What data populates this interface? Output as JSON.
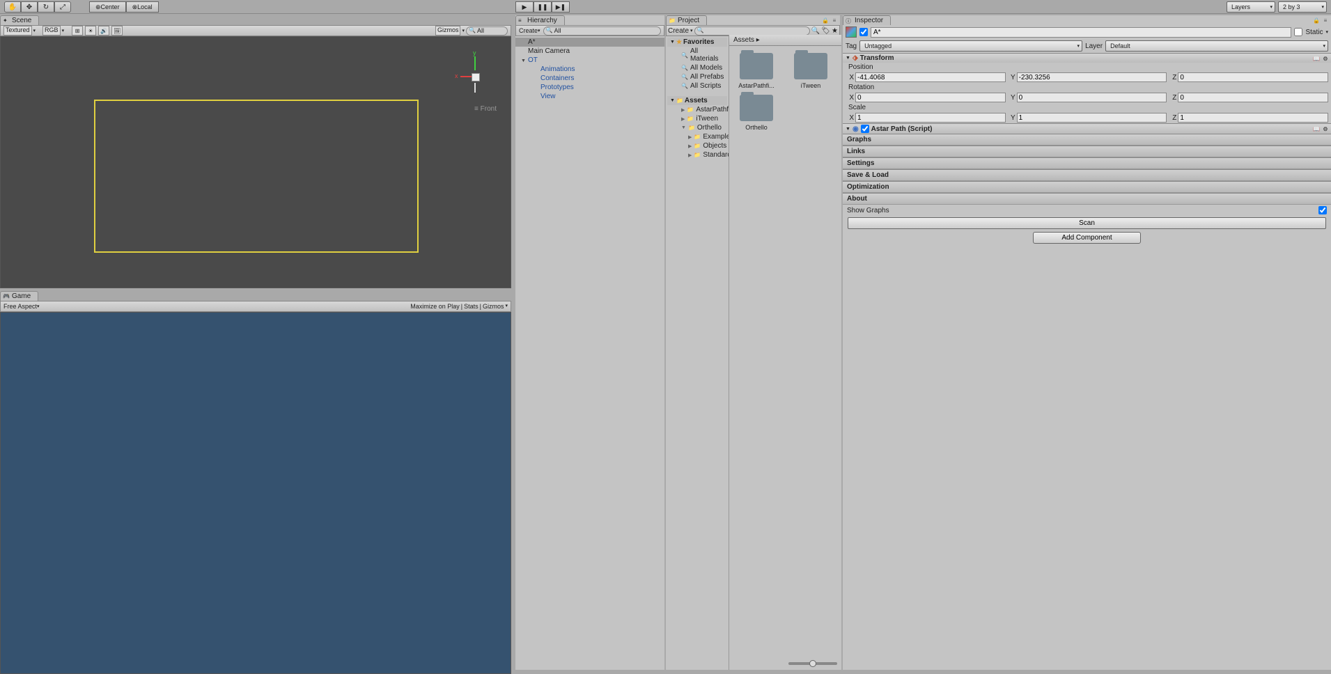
{
  "toolbar": {
    "tools": [
      "✋",
      "✥",
      "↻",
      "⤢"
    ],
    "center_label": "Center",
    "local_label": "Local",
    "play_icons": [
      "▶",
      "❚❚",
      "▶❚"
    ],
    "layers_label": "Layers",
    "layout_label": "2 by 3"
  },
  "scene": {
    "tab_label": "Scene",
    "shading": "Textured",
    "render_mode": "RGB",
    "gizmos_label": "Gizmos",
    "search_placeholder": "All",
    "front_label": "Front"
  },
  "game": {
    "tab_label": "Game",
    "aspect_label": "Free Aspect",
    "maximize_label": "Maximize on Play",
    "stats_label": "Stats",
    "gizmos_label": "Gizmos"
  },
  "hierarchy": {
    "tab_label": "Hierarchy",
    "create_label": "Create",
    "search_placeholder": "All",
    "items": [
      {
        "label": "A*",
        "selected": true,
        "depth": 0
      },
      {
        "label": "Main Camera",
        "depth": 0
      },
      {
        "label": "OT",
        "depth": 0,
        "expand": true,
        "prefab": true
      },
      {
        "label": "Animations",
        "depth": 1,
        "prefab": true
      },
      {
        "label": "Containers",
        "depth": 1,
        "prefab": true
      },
      {
        "label": "Prototypes",
        "depth": 1,
        "prefab": true
      },
      {
        "label": "View",
        "depth": 1,
        "prefab": true
      }
    ]
  },
  "project": {
    "tab_label": "Project",
    "create_label": "Create",
    "favorites_label": "Favorites",
    "favorites": [
      "All Materials",
      "All Models",
      "All Prefabs",
      "All Scripts"
    ],
    "assets_label": "Assets",
    "folders": [
      {
        "label": "AstarPathfind",
        "depth": 1
      },
      {
        "label": "iTween",
        "depth": 1
      },
      {
        "label": "Orthello",
        "depth": 1,
        "expand": true
      },
      {
        "label": "Examples",
        "depth": 2
      },
      {
        "label": "Objects",
        "depth": 2
      },
      {
        "label": "Standard",
        "depth": 2
      }
    ],
    "breadcrumb": "Assets",
    "grid_items": [
      "AstarPathfi...",
      "iTween",
      "Orthello"
    ]
  },
  "inspector": {
    "tab_label": "Inspector",
    "object_name": "A*",
    "static_label": "Static",
    "tag_label": "Tag",
    "tag_value": "Untagged",
    "layer_label": "Layer",
    "layer_value": "Default",
    "transform": {
      "title": "Transform",
      "position_label": "Position",
      "position": {
        "x": "-41.4068",
        "y": "-230.3256",
        "z": "0"
      },
      "rotation_label": "Rotation",
      "rotation": {
        "x": "0",
        "y": "0",
        "z": "0"
      },
      "scale_label": "Scale",
      "scale": {
        "x": "1",
        "y": "1",
        "z": "1"
      }
    },
    "astar": {
      "title": "Astar Path (Script)",
      "sections": [
        "Graphs",
        "Links",
        "Settings",
        "Save & Load",
        "Optimization",
        "About"
      ],
      "show_graphs_label": "Show Graphs",
      "show_graphs_checked": true,
      "scan_label": "Scan"
    },
    "add_component_label": "Add Component"
  }
}
